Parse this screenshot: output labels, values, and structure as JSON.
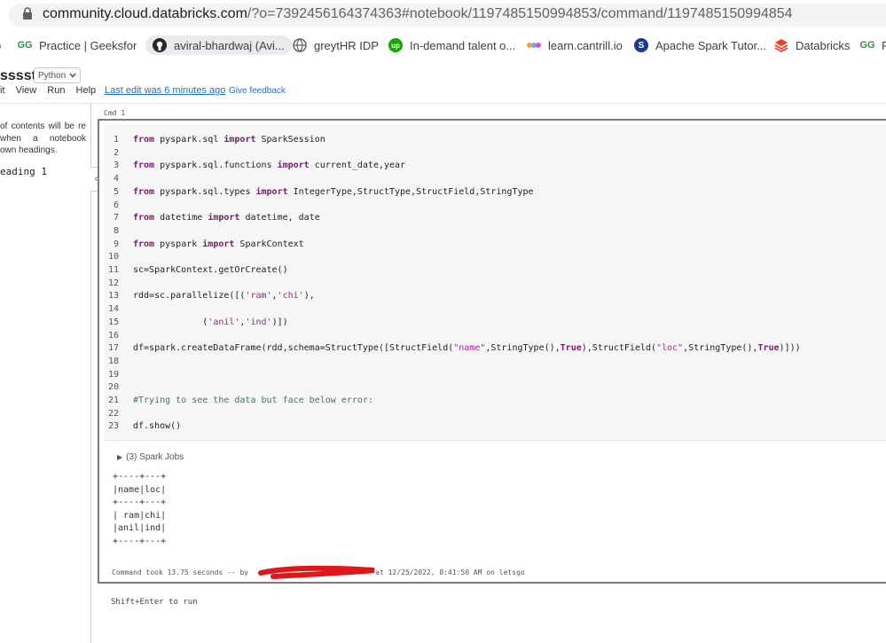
{
  "address_bar": {
    "host": "community.cloud.databricks.com",
    "path": "/?o=7392456164374363#notebook/1197485150994853/command/1197485150994854"
  },
  "bookmarks": [
    {
      "icon": "partial-bookmark-icon",
      "label": "p"
    },
    {
      "icon": "geeksforgeeks-icon",
      "label": "Practice | GeeksforGeeks..."
    },
    {
      "icon": "github-icon",
      "label": "aviral-bhardwaj (Avi..."
    },
    {
      "icon": "globe-icon",
      "label": "greytHR IDP"
    },
    {
      "icon": "upwork-icon",
      "label": "In-demand talent o..."
    },
    {
      "icon": "cantrill-icon",
      "label": "learn.cantrill.io"
    },
    {
      "icon": "spark-icon",
      "label": "Apache Spark Tutor..."
    },
    {
      "icon": "databricks-icon",
      "label": "Databricks"
    },
    {
      "icon": "geeksforgeeks-icon",
      "label": "F"
    }
  ],
  "notebook": {
    "title": "sssst",
    "language": "Python",
    "menu": [
      "it",
      "View",
      "Run",
      "Help"
    ],
    "last_edit": "Last edit was 6 minutes ago",
    "feedback": "Give feedback"
  },
  "toc": {
    "text": "of contents will be re when a notebook own headings.",
    "heading": "eading 1",
    "toggle_glyph": "‹"
  },
  "cell": {
    "label": "Cmd 1",
    "line_numbers": [
      "1",
      "2",
      "3",
      "4",
      "5",
      "6",
      "7",
      "8",
      "9",
      "10",
      "11",
      "12",
      "13",
      "14",
      "15",
      "16",
      "17",
      "18",
      "19",
      "20",
      "21",
      "22",
      "23"
    ],
    "code_lines": [
      "from pyspark.sql import SparkSession",
      "",
      "from pyspark.sql.functions import current_date,year",
      "",
      "from pyspark.sql.types import IntegerType,StructType,StructField,StringType",
      "",
      "from datetime import datetime, date",
      "",
      "from pyspark import SparkContext",
      "",
      "sc=SparkContext.getOrCreate()",
      "",
      "rdd=sc.parallelize([('ram','chi'),",
      "",
      "             ('anil','ind')])",
      "",
      "df=spark.createDataFrame(rdd,schema=StructType([StructField(\"name\",StringType(),True),StructField(\"loc\",StringType(),True)]))",
      "",
      "",
      "",
      "#Trying to see the data but face below error:",
      "",
      "df.show()"
    ],
    "spark_jobs": "(3) Spark Jobs",
    "output": "+----+---+\n|name|loc|\n+----+---+\n| ram|chi|\n|anil|ind|\n+----+---+",
    "command_took_prefix": "Command took 13.75 seconds -- by",
    "command_took_suffix": "at 12/25/2022, 8:41:50 AM on letsgo",
    "redaction_color": "#e0161b"
  },
  "footer": {
    "hint": "Shift+Enter to run"
  }
}
